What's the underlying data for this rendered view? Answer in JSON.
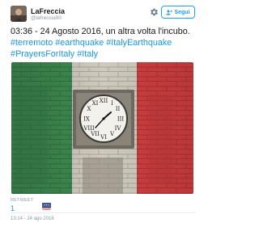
{
  "author": {
    "name": "LaFreccia",
    "handle": "@lafreccia90"
  },
  "actions": {
    "settings_icon": "gear-icon",
    "follow_label": "Segui",
    "follow_icon": "add-user-icon"
  },
  "tweet": {
    "line1": "03:36 - 24 Agosto 2016, un altra volta l'incubo.",
    "hashtags": [
      "#terremoto",
      "#earthquake",
      "#ItalyEarthquake",
      "#PrayersForItaly",
      "#Italy"
    ]
  },
  "stats": {
    "retweet_label": "RETWEET",
    "retweet_count": "1"
  },
  "timestamp": "13:14 - 24 ago 2016",
  "colors": {
    "link": "#1b95e0",
    "accent": "#1da1f2",
    "flag_green": "#3a8a4c",
    "flag_white": "#d9d4c8",
    "flag_red": "#d13b3b"
  }
}
